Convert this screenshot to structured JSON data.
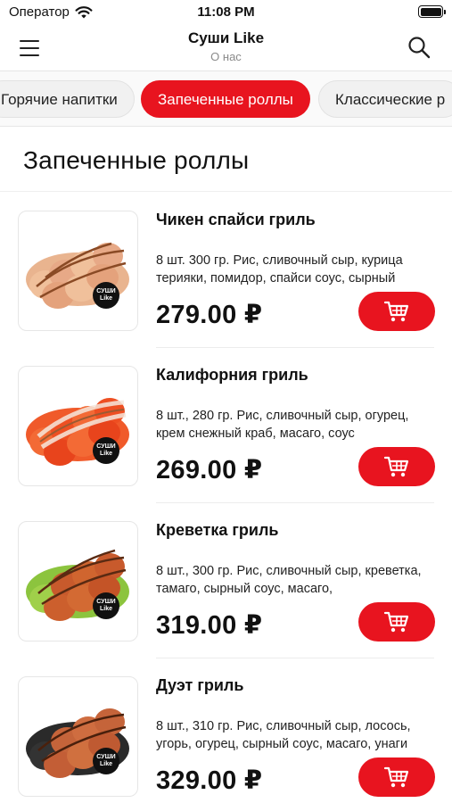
{
  "status_bar": {
    "carrier": "Оператор",
    "time": "11:08 PM"
  },
  "nav": {
    "title": "Суши Like",
    "subtitle": "О нас"
  },
  "categories": [
    {
      "label": "Горячие напитки",
      "active": false
    },
    {
      "label": "Запеченные роллы",
      "active": true
    },
    {
      "label": "Классические р",
      "active": false
    }
  ],
  "section": {
    "title": "Запеченные роллы"
  },
  "products": [
    {
      "name": "Чикен спайси гриль",
      "description": "8 шт. 300 гр. Рис, сливочный сыр, курица терияки, помидор, спайси соус, сырный",
      "price": "279.00 ₽",
      "badge": "Суши Like"
    },
    {
      "name": "Калифорния гриль",
      "description": "8 шт., 280 гр.  Рис, сливочный сыр, огурец, крем снежный краб, масаго, соус",
      "price": "269.00 ₽",
      "badge": "Суши Like"
    },
    {
      "name": "Креветка гриль",
      "description": "8 шт., 300 гр. Рис, сливочный сыр, креветка, тамаго, сырный соус, масаго,",
      "price": "319.00 ₽",
      "badge": "Суши Like"
    },
    {
      "name": "Дуэт гриль",
      "description": "8 шт., 310 гр. Рис, сливочный сыр, лосось, угорь, огурец, сырный соус, масаго, унаги",
      "price": "329.00 ₽",
      "badge": "Суши Like"
    }
  ],
  "colors": {
    "accent": "#e8141f"
  },
  "icons": {
    "menu": "hamburger-icon",
    "search": "search-icon",
    "cart": "cart-icon",
    "wifi": "wifi-icon",
    "battery": "battery-icon"
  }
}
